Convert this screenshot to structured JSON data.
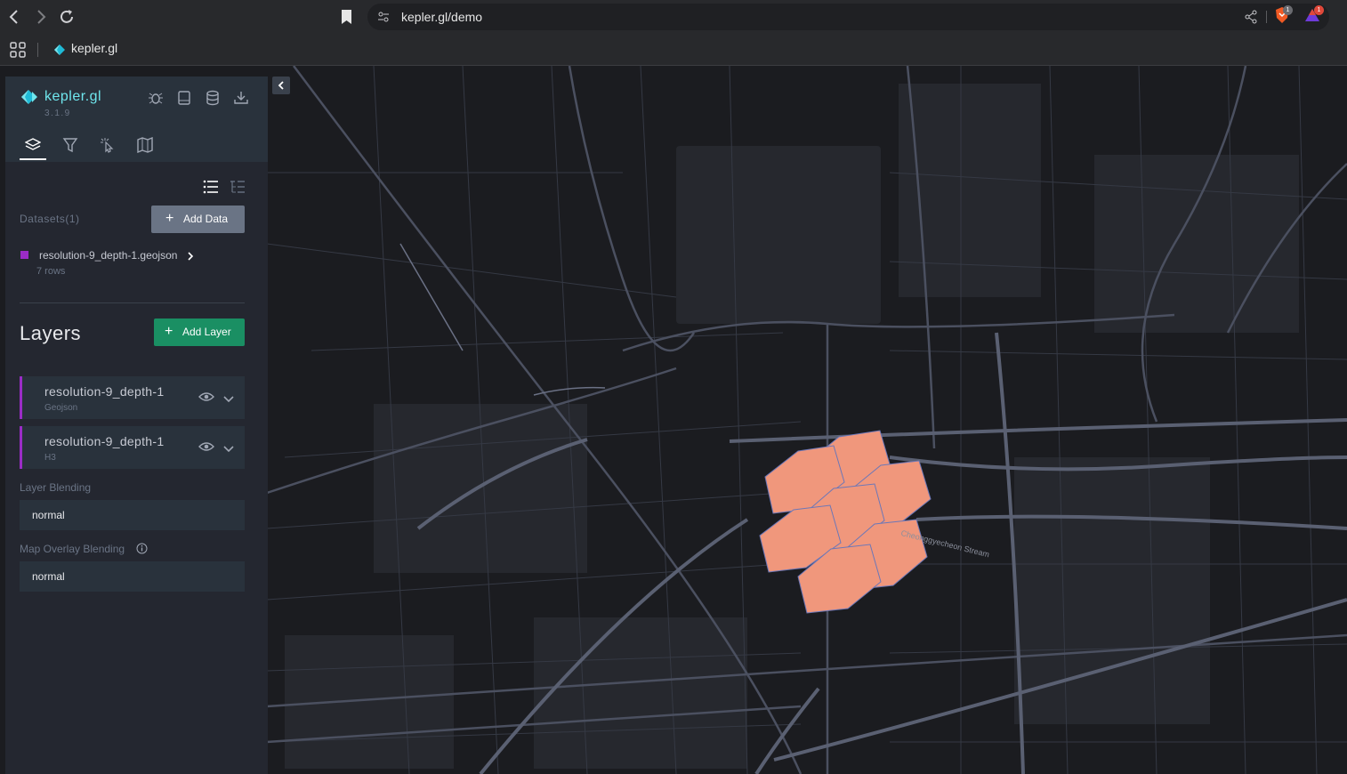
{
  "browser": {
    "url": "kepler.gl/demo",
    "tab_title": "kepler.gl",
    "shield_badge": "1",
    "rewards_badge": "1"
  },
  "app": {
    "logo_text": "kepler.gl",
    "version": "3.1.9",
    "accent_color": "#6fe6ed"
  },
  "datasets": {
    "label": "Datasets(1)",
    "add_button": "Add Data",
    "items": [
      {
        "name": "resolution-9_depth-1.geojson",
        "rows": "7 rows",
        "color": "#9a2cc6"
      }
    ]
  },
  "layers": {
    "title": "Layers",
    "add_button": "Add Layer",
    "items": [
      {
        "name": "resolution-9_depth-1",
        "type": "Geojson"
      },
      {
        "name": "resolution-9_depth-1",
        "type": "H3"
      }
    ]
  },
  "blending": {
    "layer_label": "Layer Blending",
    "layer_value": "normal",
    "overlay_label": "Map Overlay Blending",
    "overlay_value": "normal"
  },
  "map": {
    "street_label": "Cheonggyecheon Stream",
    "hex_color": "#f0977c"
  }
}
